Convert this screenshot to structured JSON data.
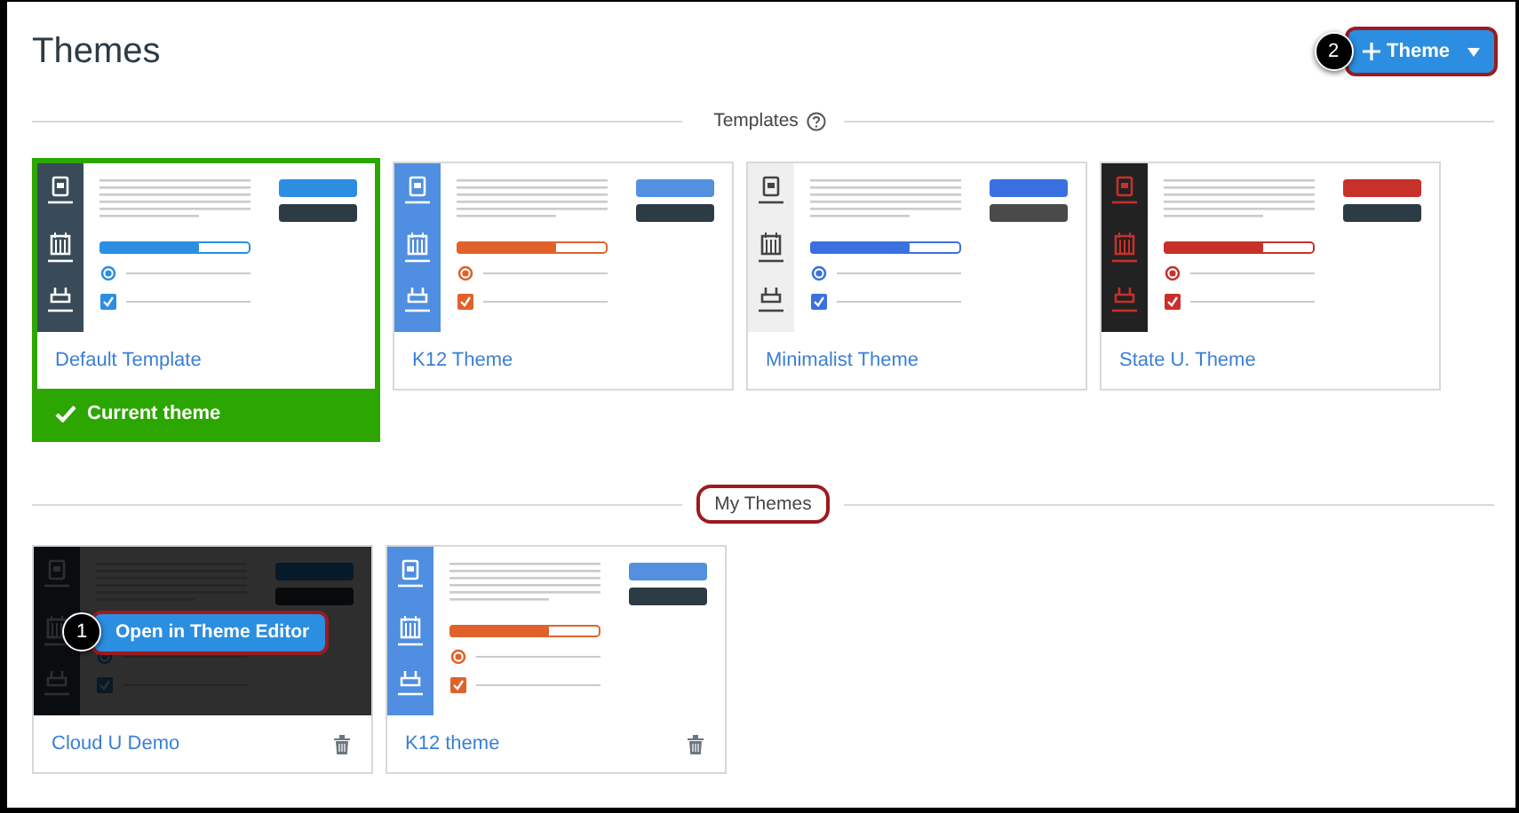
{
  "page": {
    "title": "Themes"
  },
  "add_button": {
    "label": "Theme",
    "callout": "2",
    "highlighted": true
  },
  "sections": [
    {
      "title": "Templates",
      "help": true,
      "highlighted": false,
      "themes": [
        {
          "name": "Default Template",
          "kind": "default",
          "color": "#2b8ee0",
          "current": true,
          "current_label": "Current theme",
          "deletable": false,
          "hovered": false
        },
        {
          "name": "K12 Theme",
          "kind": "k12",
          "color": "#e0622a",
          "current": false,
          "deletable": false,
          "hovered": false
        },
        {
          "name": "Minimalist Theme",
          "kind": "minimalist",
          "color": "#3a70e0",
          "current": false,
          "deletable": false,
          "hovered": false
        },
        {
          "name": "State U. Theme",
          "kind": "stateu",
          "color": "#c8302a",
          "current": false,
          "deletable": false,
          "hovered": false
        }
      ]
    },
    {
      "title": "My Themes",
      "help": false,
      "highlighted": true,
      "themes": [
        {
          "name": "Cloud U Demo",
          "kind": "default",
          "color": "#2b8ee0",
          "current": false,
          "deletable": true,
          "hovered": true,
          "action": {
            "label": "Open in Theme Editor",
            "callout": "1",
            "highlighted": true
          }
        },
        {
          "name": "K12 theme",
          "kind": "k12",
          "color": "#e0622a",
          "current": false,
          "deletable": true,
          "hovered": false
        }
      ]
    }
  ]
}
